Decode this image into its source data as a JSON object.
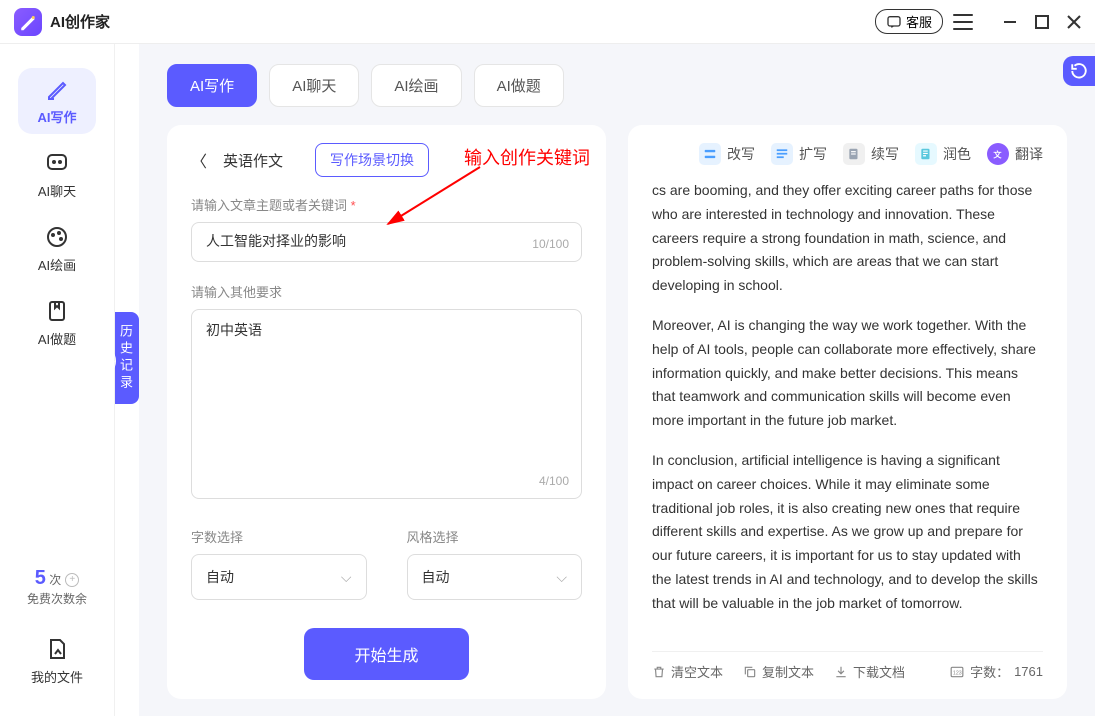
{
  "app_title": "AI创作家",
  "title_bar": {
    "kefu": "客服"
  },
  "sidebar": {
    "items": [
      {
        "label": "AI写作"
      },
      {
        "label": "AI聊天"
      },
      {
        "label": "AI绘画"
      },
      {
        "label": "AI做题"
      }
    ],
    "free_count_num": "5",
    "free_count_unit": "次",
    "free_count_label": "免费次数余",
    "my_files": "我的文件"
  },
  "history_tab": "历史记录",
  "tabs": [
    {
      "label": "AI写作"
    },
    {
      "label": "AI聊天"
    },
    {
      "label": "AI绘画"
    },
    {
      "label": "AI做题"
    }
  ],
  "left_panel": {
    "breadcrumb": "英语作文",
    "scene_switch": "写作场景切换",
    "topic_label": "请输入文章主题或者关键词",
    "topic_value": "人工智能对择业的影响",
    "topic_counter": "10/100",
    "other_label": "请输入其他要求",
    "other_value": "初中英语",
    "other_counter": "4/100",
    "word_count_label": "字数选择",
    "word_count_value": "自动",
    "style_label": "风格选择",
    "style_value": "自动",
    "generate_btn": "开始生成"
  },
  "right_panel": {
    "tools": [
      {
        "label": "改写"
      },
      {
        "label": "扩写"
      },
      {
        "label": "续写"
      },
      {
        "label": "润色"
      },
      {
        "label": "翻译"
      }
    ],
    "paragraphs": [
      "cs are booming, and they offer exciting career paths for those who are interested in technology and innovation. These careers require a strong foundation in math, science, and problem-solving skills, which are areas that we can start developing in school.",
      "Moreover, AI is changing the way we work together. With the help of AI tools, people can collaborate more effectively, share information quickly, and make better decisions. This means that teamwork and communication skills will become even more important in the future job market.",
      "In conclusion, artificial intelligence is having a significant impact on career choices. While it may eliminate some traditional job roles, it is also creating new ones that require different skills and expertise. As we grow up and prepare for our future careers, it is important for us to stay updated with the latest trends in AI and technology, and to develop the skills that will be valuable in the job market of tomorrow."
    ],
    "footer": {
      "clear": "清空文本",
      "copy": "复制文本",
      "download": "下载文档",
      "word_count_label": "字数：",
      "word_count": "1761"
    }
  },
  "annotation": "输入创作关键词"
}
